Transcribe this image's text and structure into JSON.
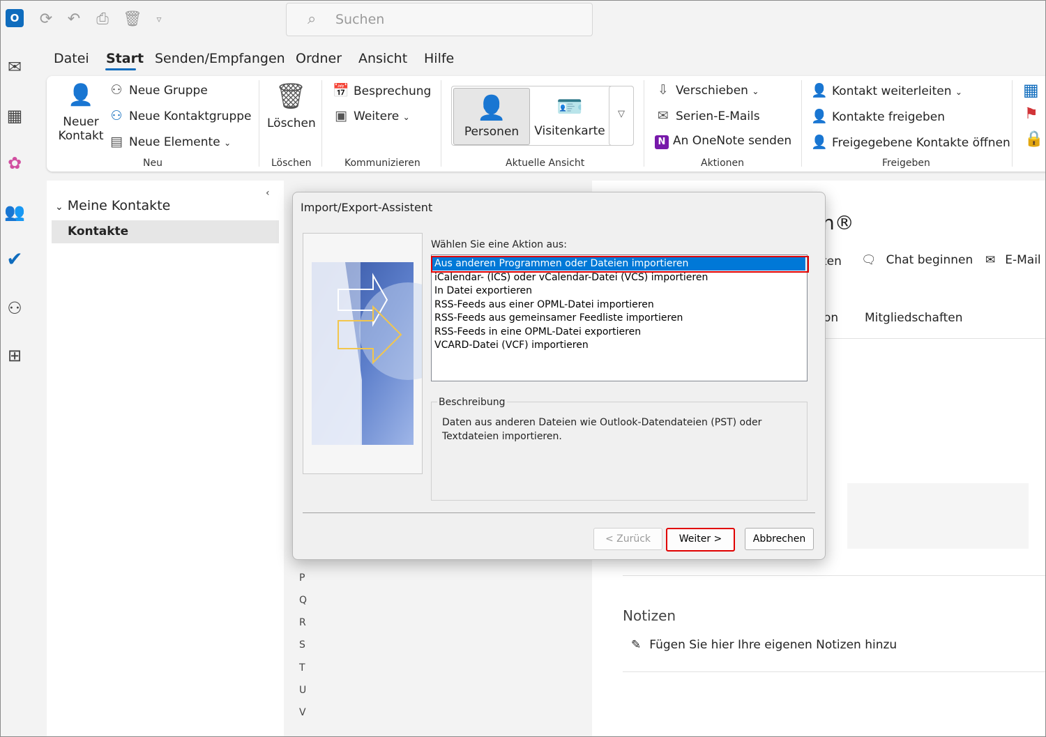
{
  "search": {
    "placeholder": "Suchen"
  },
  "menu": [
    "Datei",
    "Start",
    "Senden/Empfangen",
    "Ordner",
    "Ansicht",
    "Hilfe"
  ],
  "ribbon": {
    "neu": {
      "new_contact_line1": "Neuer",
      "new_contact_line2": "Kontakt",
      "new_group": "Neue Gruppe",
      "new_contact_group": "Neue Kontaktgruppe",
      "new_items": "Neue Elemente",
      "group_label": "Neu"
    },
    "loeschen": {
      "delete": "Löschen",
      "group_label": "Löschen"
    },
    "kommunizieren": {
      "meeting": "Besprechung",
      "more": "Weitere",
      "group_label": "Kommunizieren"
    },
    "ansicht": {
      "persons": "Personen",
      "business_card": "Visitenkarte",
      "group_label": "Aktuelle Ansicht"
    },
    "aktionen": {
      "move": "Verschieben",
      "mail_merge": "Serien-E-Mails",
      "onenote": "An OneNote senden",
      "group_label": "Aktionen"
    },
    "freigeben": {
      "forward_contact": "Kontakt weiterleiten",
      "share_contacts": "Kontakte freigeben",
      "open_shared": "Freigegebene Kontakte öffnen",
      "group_label": "Freigeben"
    }
  },
  "folders": {
    "section": "Meine Kontakte",
    "selected": "Kontakte"
  },
  "alpha_index": [
    "P",
    "Q",
    "R",
    "S",
    "T",
    "U",
    "V"
  ],
  "detail": {
    "name_partial": "n®",
    "action_partial_1": "ten",
    "chat": "Chat beginnen",
    "email_partial": "E-Mail",
    "tab_partial": "on",
    "tab_memberships": "Mitgliedschaften",
    "notes_title": "Notizen",
    "notes_placeholder": "Fügen Sie hier Ihre eigenen Notizen hinzu"
  },
  "dialog": {
    "title": "Import/Export-Assistent",
    "prompt": "Wählen Sie eine Aktion aus:",
    "actions": [
      "Aus anderen Programmen oder Dateien importieren",
      "iCalendar- (ICS) oder vCalendar-Datei (VCS) importieren",
      "In Datei exportieren",
      "RSS-Feeds aus einer OPML-Datei importieren",
      "RSS-Feeds aus gemeinsamer Feedliste importieren",
      "RSS-Feeds in eine OPML-Datei exportieren",
      "VCARD-Datei (VCF) importieren"
    ],
    "description_label": "Beschreibung",
    "description_line1": "Daten aus anderen Dateien wie Outlook-Datendateien (PST) oder",
    "description_line2": "Textdateien importieren.",
    "back": "< Zurück",
    "next": "Weiter >",
    "cancel": "Abbrechen"
  },
  "colors": {
    "accent": "#0f6cbd",
    "selection": "#0078d7",
    "highlight": "#e00000"
  }
}
